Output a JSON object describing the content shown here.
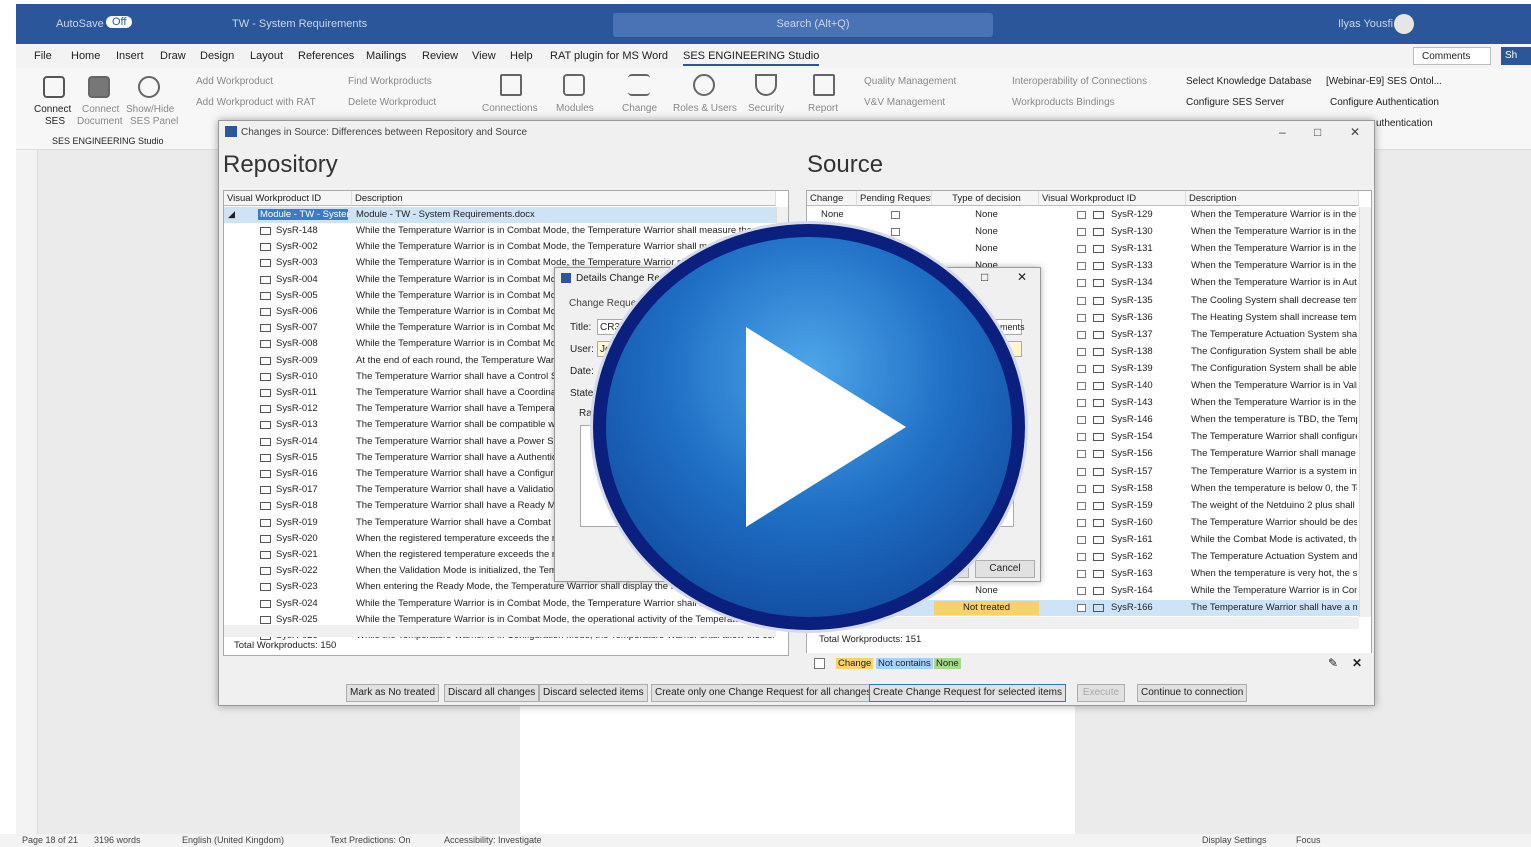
{
  "titlebar": {
    "autosave": "AutoSave",
    "toggle": "Off",
    "doc_title": "TW - System Requirements",
    "search_placeholder": "Search (Alt+Q)",
    "user": "Ilyas Yousfi"
  },
  "menu": [
    "File",
    "Home",
    "Insert",
    "Draw",
    "Design",
    "Layout",
    "References",
    "Mailings",
    "Review",
    "View",
    "Help",
    "RAT plugin for MS Word",
    "SES ENGINEERING Studio"
  ],
  "menu_right": {
    "comments": "Comments",
    "share": "Sh"
  },
  "ribbon": {
    "connect": "Connect",
    "ses": "SES",
    "connect_doc": "Connect",
    "document": "Document",
    "show_hide": "Show/Hide",
    "ses_panel": "SES Panel",
    "group_label": "SES ENGINEERING Studio",
    "add_wp": "Add Workproduct",
    "add_wp_rat": "Add Workproduct with RAT",
    "find_wp": "Find Workproducts",
    "delete_wp": "Delete Workproduct",
    "connections": "Connections",
    "modules": "Modules",
    "change": "Change",
    "roles_users": "Roles & Users",
    "security": "Security",
    "report": "Report",
    "quality": "Quality Management",
    "vv": "V&V Management",
    "interop": "Interoperability of Connections",
    "wp_bindings": "Workproducts Bindings",
    "select_kb": "Select Knowledge Database",
    "kb_value": "[Webinar-E9] SES Ontol...",
    "configure_server": "Configure SES Server",
    "configure_auth": "Configure Authentication",
    "authentication": "uthentication"
  },
  "dialog": {
    "title": "Changes in Source: Differences between Repository and Source",
    "repo_heading": "Repository",
    "source_heading": "Source",
    "repo_cols": [
      "Visual Workproduct ID",
      "Description"
    ],
    "repo_module": {
      "id": "Module - TW - System",
      "desc": "Module - TW - System Requirements.docx"
    },
    "repo_rows": [
      {
        "id": "SysR-148",
        "desc": "While the Temperature Warrior is in Combat Mode, the Temperature Warrior shall measure the ph"
      },
      {
        "id": "SysR-002",
        "desc": "While the Temperature Warrior is in Combat Mode, the Temperature Warrior shall modif"
      },
      {
        "id": "SysR-003",
        "desc": "While the Temperature Warrior is in Combat Mode, the Temperature Warrior shal"
      },
      {
        "id": "SysR-004",
        "desc": "While the Temperature Warrior is in Combat Mode"
      },
      {
        "id": "SysR-005",
        "desc": "While the Temperature Warrior is in Combat Mode"
      },
      {
        "id": "SysR-006",
        "desc": "While the Temperature Warrior is in Combat Mode"
      },
      {
        "id": "SysR-007",
        "desc": "While the Temperature Warrior is in Combat Mode"
      },
      {
        "id": "SysR-008",
        "desc": "While the Temperature Warrior is in Combat Mode"
      },
      {
        "id": "SysR-009",
        "desc": "At the end of each round, the Temperature Warrio"
      },
      {
        "id": "SysR-010",
        "desc": "The Temperature Warrior shall have a Control Sy"
      },
      {
        "id": "SysR-011",
        "desc": "The Temperature Warrior shall have a Coordinatio"
      },
      {
        "id": "SysR-012",
        "desc": "The Temperature Warrior shall have a Temperatu"
      },
      {
        "id": "SysR-013",
        "desc": "The Temperature Warrior shall be compatible with"
      },
      {
        "id": "SysR-014",
        "desc": "The Temperature Warrior shall have a Power Sub"
      },
      {
        "id": "SysR-015",
        "desc": "The Temperature Warrior shall have a Authenticat"
      },
      {
        "id": "SysR-016",
        "desc": "The Temperature Warrior shall have a Configurati"
      },
      {
        "id": "SysR-017",
        "desc": "The Temperature Warrior shall have a Validation I"
      },
      {
        "id": "SysR-018",
        "desc": "The Temperature Warrior shall have a Ready Moc"
      },
      {
        "id": "SysR-019",
        "desc": "The Temperature Warrior shall have a Combat Mc"
      },
      {
        "id": "SysR-020",
        "desc": "When the registered temperature exceeds the ma"
      },
      {
        "id": "SysR-021",
        "desc": "When the registered temperature exceeds the min"
      },
      {
        "id": "SysR-022",
        "desc": "When the Validation Mode is initialized, the Temp"
      },
      {
        "id": "SysR-023",
        "desc": "When entering the Ready Mode, the Temperature Warrior shall display the Read"
      },
      {
        "id": "SysR-024",
        "desc": "While the Temperature Warrior is in Combat Mode, the Temperature Warrior shall ma"
      },
      {
        "id": "SysR-025",
        "desc": "While the Temperature Warrior is in Combat Mode, the operational activity of the Temperature"
      },
      {
        "id": "SysR-026",
        "desc": "While the Temperature Warrior is in Configuration Mode, the Temperature Warrior shall allow the configur"
      }
    ],
    "repo_total": "Total Workproducts: 150",
    "src_cols": [
      "Change",
      "Pending Request",
      "Type of decision",
      "Visual Workproduct ID",
      "Description"
    ],
    "src_rows": [
      {
        "change": "None",
        "decision": "None",
        "id": "SysR-129",
        "desc": "When the Temperature Warrior is in the Re"
      },
      {
        "change": "",
        "decision": "None",
        "id": "SysR-130",
        "desc": "When the Temperature Warrior is in the Co"
      },
      {
        "change": "",
        "decision": "None",
        "id": "SysR-131",
        "desc": "When the Temperature Warrior is in the Re"
      },
      {
        "change": "",
        "decision": "None",
        "id": "SysR-133",
        "desc": "When the Temperature Warrior is in the Re"
      },
      {
        "change": "",
        "decision": "",
        "id": "SysR-134",
        "desc": "When the Temperature Warrior is in Authe"
      },
      {
        "change": "",
        "decision": "",
        "id": "SysR-135",
        "desc": "The Cooling System shall decrease tempe"
      },
      {
        "change": "",
        "decision": "",
        "id": "SysR-136",
        "desc": "The Heating System shall increase temper"
      },
      {
        "change": "",
        "decision": "",
        "id": "SysR-137",
        "desc": "The Temperature Actuation System shall r"
      },
      {
        "change": "",
        "decision": "",
        "id": "SysR-138",
        "desc": "The Configuration System shall be able to"
      },
      {
        "change": "",
        "decision": "",
        "id": "SysR-139",
        "desc": "The Configuration System shall be able of"
      },
      {
        "change": "",
        "decision": "",
        "id": "SysR-140",
        "desc": "When the Temperature Warrior is in Valida"
      },
      {
        "change": "",
        "decision": "",
        "id": "SysR-143",
        "desc": "When the Temperature Warrior is in the Co"
      },
      {
        "change": "",
        "decision": "",
        "id": "SysR-146",
        "desc": "When the temperature is TBD, the Temper"
      },
      {
        "change": "",
        "decision": "",
        "id": "SysR-154",
        "desc": "The Temperature Warrior shall configure tl"
      },
      {
        "change": "",
        "decision": "",
        "id": "SysR-156",
        "desc": "The Temperature Warrior shall manage th"
      },
      {
        "change": "",
        "decision": "",
        "id": "SysR-157",
        "desc": "The Temperature Warrior is a system inter"
      },
      {
        "change": "",
        "decision": "",
        "id": "SysR-158",
        "desc": "When the temperature is below 0, the Tem"
      },
      {
        "change": "",
        "decision": "",
        "id": "SysR-159",
        "desc": "The weight of the Netduino 2 plus shall be"
      },
      {
        "change": "",
        "decision": "",
        "id": "SysR-160",
        "desc": "The Temperature Warrior should be desig"
      },
      {
        "change": "",
        "decision": "",
        "id": "SysR-161",
        "desc": "While the Combat Mode is activated, the e"
      },
      {
        "change": "",
        "decision": "",
        "id": "SysR-162",
        "desc": "The Temperature Actuation System and th"
      },
      {
        "change": "",
        "decision": "",
        "id": "SysR-163",
        "desc": "When the temperature is very hot, the syst"
      },
      {
        "change": "",
        "decision": "None",
        "id": "SysR-164",
        "desc": "While the Temperature Warrior is in Comb"
      },
      {
        "change": "",
        "decision": "Not treated",
        "id": "SysR-166",
        "desc": "The Temperature Warrior shall have a mas"
      }
    ],
    "src_total": "Total Workproducts: 151",
    "legend": [
      "Change",
      "Not contains",
      "None"
    ],
    "buttons": [
      "Mark as No treated",
      "Discard all changes",
      "Discard selected items",
      "Create only one Change Request for all changes",
      "Create Change Request for selected items",
      "Execute",
      "Continue to connection"
    ]
  },
  "inner": {
    "title": "Details Change Re",
    "group": "Change Reque",
    "title_label": "Title:",
    "title_value": "CR3",
    "user_label": "User:",
    "user_value": "Je",
    "date_label": "Date:",
    "state_label": "State",
    "rat_label": "Rat",
    "req_value": "equirements",
    "ok_text": "e",
    "cancel": "Cancel"
  },
  "status": {
    "page": "Page 18 of 21",
    "words": "3196 words",
    "lang": "English (United Kingdom)",
    "predictions": "Text Predictions: On",
    "accessibility": "Accessibility: Investigate",
    "display": "Display Settings",
    "focus": "Focus"
  },
  "colors": {
    "word_blue": "#2b579a",
    "change_legend": "#f5d26b",
    "not_contains": "#a9d0f5",
    "none_legend": "#a8d88f",
    "play_blue": "#1f6fc5"
  }
}
